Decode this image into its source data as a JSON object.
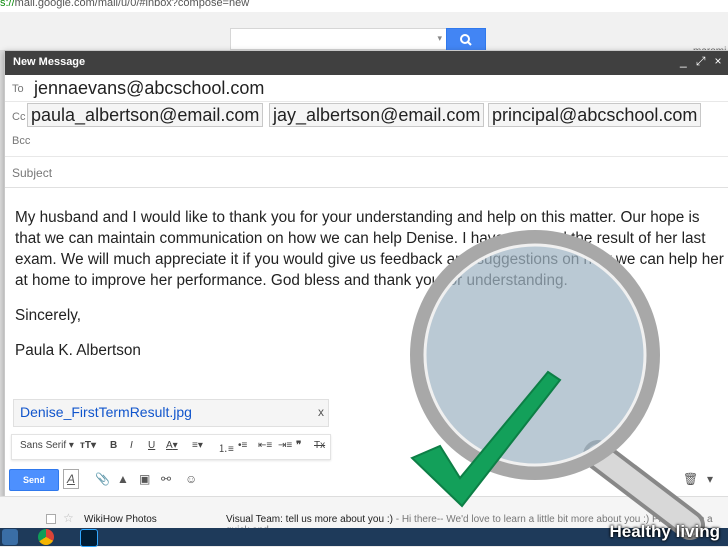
{
  "browser": {
    "url_scheme": "s://",
    "url_rest": "mail.google.com/mail/u/0/#inbox?compose=new"
  },
  "header": {
    "search_dropdown_icon": "caret-down-icon",
    "search_button_icon": "search-icon",
    "user_name": "maromi"
  },
  "compose": {
    "title": "New Message",
    "controls": {
      "minimize": "_",
      "popout": "⤢",
      "close": "×"
    },
    "to_label": "To",
    "to_value": "jennaevans@abcschool.com",
    "cc_label": "Cc",
    "cc_recipients": [
      "paula_albertson@email.com",
      "jay_albertson@email.com",
      "principal@abcschool.com"
    ],
    "bcc_label": "Bcc",
    "subject_label": "Subject",
    "body_paragraphs": [
      "My husband and I would like to thank you for your understanding and help on this matter.  Our hope is that we can maintain communication on how we can help Denise. I have attached the result of her last exam.  We will much appreciate it if you would give us feedback and suggestions on how we can help her at home to improve her performance. God bless and thank you for understanding.",
      "Sincerely,",
      "Paula K. Albertson"
    ],
    "attachment": {
      "filename": "Denise_FirstTermResult.jpg",
      "remove": "x"
    },
    "format_bar": {
      "font": "Sans Serif",
      "size_icon": "text-size-icon",
      "bold": "B",
      "italic": "I",
      "underline": "U",
      "text_color": "A",
      "align_icon": "align-icon",
      "numbered_list_icon": "numbered-list-icon",
      "bulleted_list_icon": "bulleted-list-icon",
      "indent_less_icon": "indent-less-icon",
      "indent_more_icon": "indent-more-icon",
      "quote": "❞",
      "clear": "Tx"
    },
    "send_label": "Send",
    "bottom_icons": [
      "format-icon",
      "attach-icon",
      "drive-icon",
      "photo-icon",
      "link-icon",
      "emoji-icon",
      "trash-icon",
      "more-icon"
    ]
  },
  "inbox_row": {
    "sender": "WikiHow Photos",
    "subject": "Visual Team: tell us more about you :)",
    "snippet": " - Hi there-- We'd love to learn a little bit more about you :) Please take a quick and"
  },
  "watermark": {
    "brand": "Healthy living"
  },
  "colors": {
    "compose_header": "#404040",
    "send": "#4d90fe",
    "link": "#1155cc",
    "check": "#13a05a"
  }
}
